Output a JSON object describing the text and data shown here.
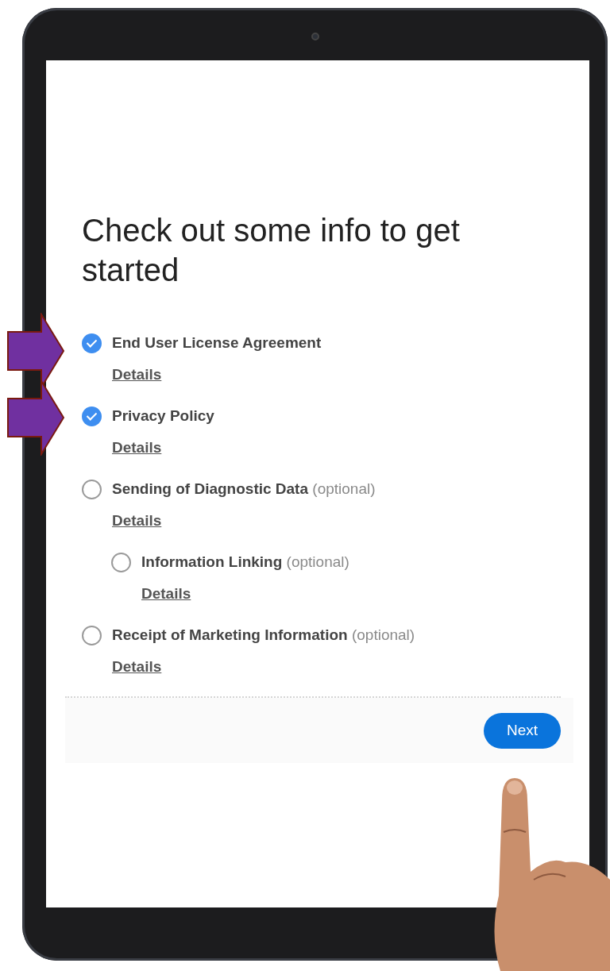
{
  "title": "Check out some info to get started",
  "items": [
    {
      "label": "End User License Agreement",
      "checked": true,
      "link": "Details"
    },
    {
      "label": "Privacy Policy",
      "checked": true,
      "link": "Details"
    },
    {
      "label": "Sending of Diagnostic Data",
      "note": "(optional)",
      "checked": false,
      "link": "Details",
      "children": [
        {
          "label": "Information Linking",
          "note": "(optional)",
          "checked": false,
          "link": "Details"
        }
      ]
    },
    {
      "label": "Receipt of Marketing Information",
      "note": "(optional)",
      "checked": false,
      "link": "Details"
    }
  ],
  "next_button": "Next"
}
